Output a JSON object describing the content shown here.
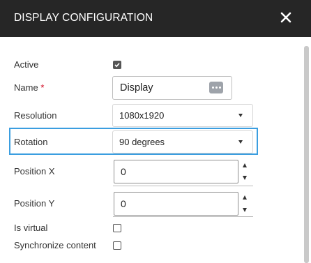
{
  "dialog": {
    "title": "DISPLAY CONFIGURATION",
    "close_icon": "close-icon"
  },
  "form": {
    "active": {
      "label": "Active",
      "checked": true
    },
    "name": {
      "label": "Name",
      "required_mark": "*",
      "value": "Display",
      "button_icon": "more-dots-icon"
    },
    "resolution": {
      "label": "Resolution",
      "value": "1080x1920"
    },
    "rotation": {
      "label": "Rotation",
      "value": "90 degrees"
    },
    "position_x": {
      "label": "Position X",
      "value": "0"
    },
    "position_y": {
      "label": "Position Y",
      "value": "0"
    },
    "is_virtual": {
      "label": "Is virtual",
      "checked": false
    },
    "synchronize_content": {
      "label": "Synchronize content",
      "checked": false
    }
  },
  "colors": {
    "header_bg": "#262626",
    "highlight": "#3b9ee0",
    "required": "#d0021b"
  }
}
